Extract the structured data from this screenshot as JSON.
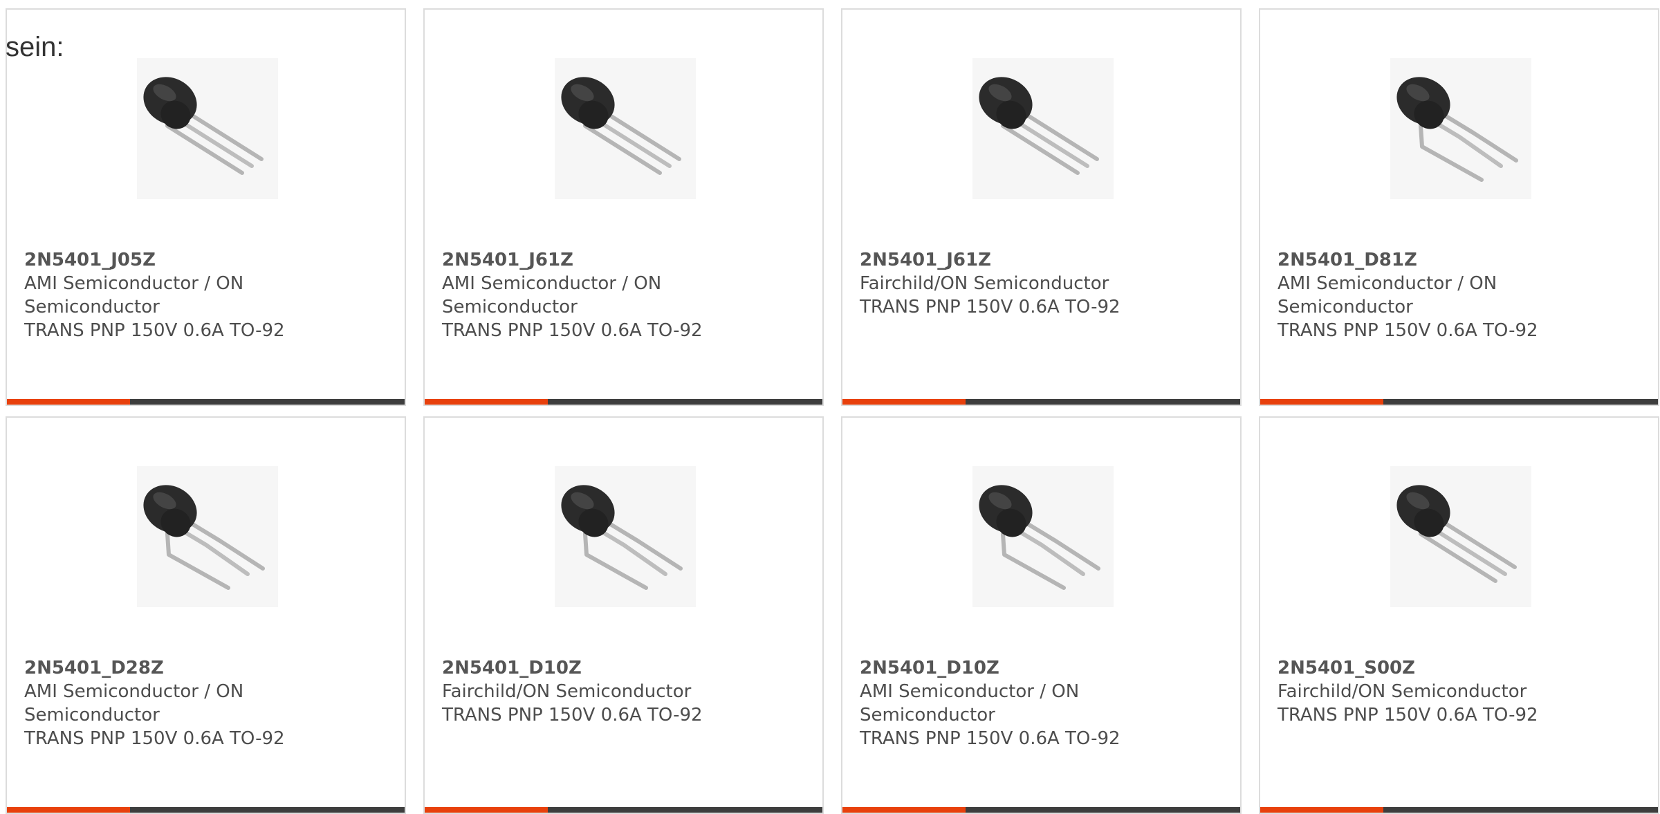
{
  "intro_text": "sein:",
  "colors": {
    "accent": "#e8400c",
    "bar": "#3d3d3d",
    "border": "#dcdcdc",
    "text": "#4d4d4d"
  },
  "accent_fraction": 0.31,
  "cards": [
    {
      "part_number": "2N5401_J05Z",
      "manufacturer": "AMI Semiconductor / ON Semiconductor",
      "description": "TRANS PNP 150V 0.6A TO-92",
      "image_icon": "to92-transistor-straight-leads-icon"
    },
    {
      "part_number": "2N5401_J61Z",
      "manufacturer": "AMI Semiconductor / ON Semiconductor",
      "description": "TRANS PNP 150V 0.6A TO-92",
      "image_icon": "to92-transistor-straight-leads-icon"
    },
    {
      "part_number": "2N5401_J61Z",
      "manufacturer": "Fairchild/ON Semiconductor",
      "description": "TRANS PNP 150V 0.6A TO-92",
      "image_icon": "to92-transistor-straight-leads-icon"
    },
    {
      "part_number": "2N5401_D81Z",
      "manufacturer": "AMI Semiconductor / ON Semiconductor",
      "description": "TRANS PNP 150V 0.6A TO-92",
      "image_icon": "to92-transistor-bent-leads-icon"
    },
    {
      "part_number": "2N5401_D28Z",
      "manufacturer": "AMI Semiconductor / ON Semiconductor",
      "description": "TRANS PNP 150V 0.6A TO-92",
      "image_icon": "to92-transistor-bent-leads-icon"
    },
    {
      "part_number": "2N5401_D10Z",
      "manufacturer": "Fairchild/ON Semiconductor",
      "description": "TRANS PNP 150V 0.6A TO-92",
      "image_icon": "to92-transistor-bent-leads-icon"
    },
    {
      "part_number": "2N5401_D10Z",
      "manufacturer": "AMI Semiconductor / ON Semiconductor",
      "description": "TRANS PNP 150V 0.6A TO-92",
      "image_icon": "to92-transistor-bent-leads-icon"
    },
    {
      "part_number": "2N5401_S00Z",
      "manufacturer": "Fairchild/ON Semiconductor",
      "description": "TRANS PNP 150V 0.6A TO-92",
      "image_icon": "to92-transistor-straight-leads-icon"
    }
  ]
}
